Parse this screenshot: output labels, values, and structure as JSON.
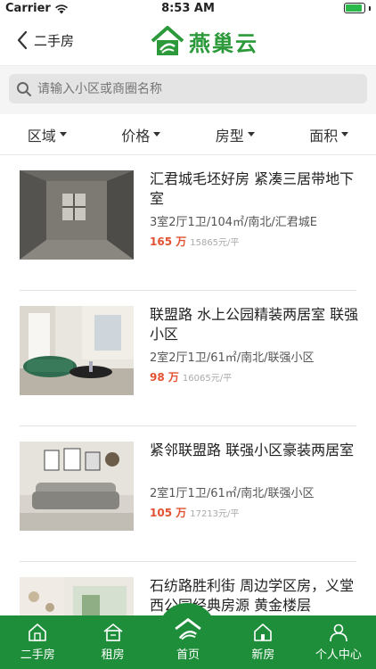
{
  "status_bar": {
    "carrier": "Carrier",
    "time": "8:53 AM",
    "battery_level": 0.9,
    "battery_color": "#2ab94a"
  },
  "nav": {
    "back_label": "二手房",
    "logo_text": "燕巢云",
    "brand_color": "#2c9a3b"
  },
  "search": {
    "placeholder": "请输入小区或商圈名称"
  },
  "filters": [
    "区域",
    "价格",
    "房型",
    "面积"
  ],
  "listings": [
    {
      "title": "汇君城毛坯好房 紧凑三居带地下室",
      "meta": "3室2厅1卫/104㎡/南北/汇君城E",
      "price": "165 万",
      "unit_price": "15865元/平"
    },
    {
      "title": "联盟路 水上公园精装两居室 联强小区",
      "meta": "2室2厅1卫/61㎡/南北/联强小区",
      "price": "98 万",
      "unit_price": "16065元/平"
    },
    {
      "title": "紧邻联盟路 联强小区豪装两居室",
      "meta": "2室1厅1卫/61㎡/南北/联强小区",
      "price": "105 万",
      "unit_price": "17213元/平"
    },
    {
      "title": "石纺路胜利街 周边学区房，义堂西公园经典房源 黄金楼层",
      "meta": "",
      "price": "",
      "unit_price": ""
    }
  ],
  "tabs": [
    {
      "label": "二手房",
      "icon": "house-icon"
    },
    {
      "label": "租房",
      "icon": "rent-icon"
    },
    {
      "label": "首页",
      "icon": "home-logo-icon"
    },
    {
      "label": "新房",
      "icon": "new-house-icon"
    },
    {
      "label": "个人中心",
      "icon": "user-icon"
    }
  ],
  "tab_bar_color": "#1f8e3a",
  "price_color": "#e35232"
}
